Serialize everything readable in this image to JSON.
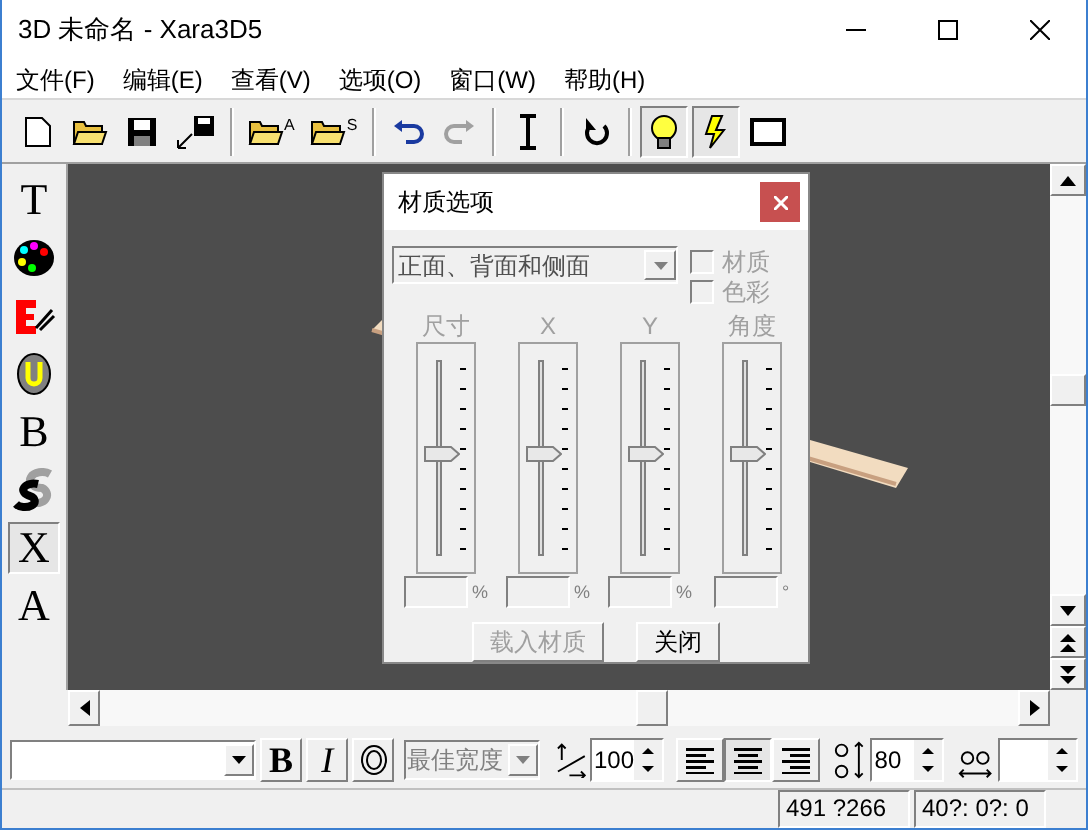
{
  "window": {
    "title": "3D 未命名 - Xara3D5"
  },
  "menu": [
    "文件(F)",
    "编辑(E)",
    "查看(V)",
    "选项(O)",
    "窗口(W)",
    "帮助(H)"
  ],
  "toolbar": [
    {
      "kind": "new",
      "selected": false
    },
    {
      "kind": "open",
      "selected": false
    },
    {
      "kind": "save",
      "selected": false
    },
    {
      "kind": "export",
      "selected": false
    },
    {
      "kind": "sep"
    },
    {
      "kind": "open-a",
      "label": "A",
      "selected": false
    },
    {
      "kind": "open-s",
      "label": "S",
      "selected": false
    },
    {
      "kind": "sep"
    },
    {
      "kind": "undo",
      "selected": false
    },
    {
      "kind": "redo",
      "selected": false,
      "disabled": true
    },
    {
      "kind": "sep"
    },
    {
      "kind": "text-cursor",
      "selected": false
    },
    {
      "kind": "sep"
    },
    {
      "kind": "rotate",
      "selected": false
    },
    {
      "kind": "sep"
    },
    {
      "kind": "bulb",
      "selected": true
    },
    {
      "kind": "bolt",
      "selected": true
    },
    {
      "kind": "frame",
      "selected": false
    }
  ],
  "tools": [
    {
      "kind": "glyph",
      "glyph": "T",
      "selected": false
    },
    {
      "kind": "palette",
      "selected": false
    },
    {
      "kind": "edit",
      "selected": false
    },
    {
      "kind": "outline",
      "selected": false
    },
    {
      "kind": "glyph",
      "glyph": "B",
      "selected": false
    },
    {
      "kind": "shadow",
      "selected": false
    },
    {
      "kind": "glyph",
      "glyph": "X",
      "selected": true
    },
    {
      "kind": "glyph",
      "glyph": "A",
      "selected": false
    }
  ],
  "dialog": {
    "title": "材质选项",
    "dropdown": {
      "value": "正面、背面和侧面",
      "disabled": true
    },
    "checkboxes": [
      {
        "label": "材质",
        "checked": false,
        "disabled": true
      },
      {
        "label": "色彩",
        "checked": false,
        "disabled": true
      }
    ],
    "sliders": [
      {
        "label": "尺寸",
        "unit": "%",
        "level": 0.53
      },
      {
        "label": "X",
        "unit": "%",
        "level": 0.53
      },
      {
        "label": "Y",
        "unit": "%",
        "level": 0.53
      },
      {
        "label": "角度",
        "unit": "°",
        "level": 0.53
      }
    ],
    "buttons": [
      {
        "label": "载入材质",
        "disabled": true
      },
      {
        "label": "关闭",
        "disabled": false
      }
    ]
  },
  "format_bar": {
    "bold": "B",
    "italic": "I",
    "width_mode": {
      "value": "最佳宽度",
      "disabled": true
    },
    "spacing": "100",
    "align": [
      {
        "kind": "left",
        "selected": false
      },
      {
        "kind": "center",
        "selected": true
      },
      {
        "kind": "right",
        "selected": false
      }
    ],
    "line_spacing": "80"
  },
  "status_bar": [
    "491 ?266",
    "40?: 0?: 0"
  ]
}
